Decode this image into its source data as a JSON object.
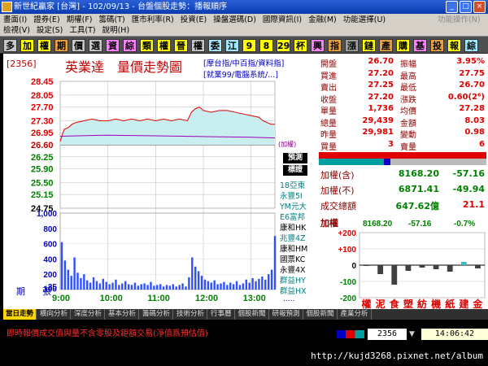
{
  "window": {
    "title": "新世紀贏家 [台灣] - 102/09/13 - 台盤個股走勢：播報順序",
    "buttons": [
      "_",
      "□",
      "×"
    ]
  },
  "menu": {
    "row1": [
      "畫面(I)",
      "證券(E)",
      "期權(F)",
      "籌碼(T)",
      "匯市利率(R)",
      "投資(E)",
      "操盤選碼(D)",
      "國際資訊(I)",
      "金融(M)",
      "功能選擇(U)"
    ],
    "row1_right": "功能操作(N)",
    "row2": [
      "檢視(V)",
      "設定(S)",
      "工具(T)",
      "說明(H)"
    ]
  },
  "toolbar": {
    "items": [
      "多",
      "加",
      "權",
      "期",
      "價",
      "選",
      "資",
      "綜",
      "類",
      "權",
      "晉",
      "權",
      "委",
      "江",
      "9",
      "8",
      "29",
      "杯",
      "興",
      "指",
      "漲",
      "鏈",
      "產",
      "購",
      "基",
      "投",
      "報",
      "綜"
    ]
  },
  "header": {
    "code": "2356",
    "name": "英業達",
    "subtitle": "量價走勢圖",
    "links1": "[摩台指/中百指/資料指]",
    "links2": "[就業99/電腦系統/...]",
    "side_note": "(加權)"
  },
  "chart_data": {
    "type": "line",
    "title": "量價走勢圖",
    "reference_price": 26.6,
    "price_ticks": [
      28.45,
      28.05,
      27.7,
      27.3,
      26.95,
      26.6,
      26.25,
      25.9,
      25.5,
      25.15,
      24.75
    ],
    "price_ylim": [
      24.75,
      28.45
    ],
    "volume_ticks": [
      "1,000",
      "800",
      "600",
      "400",
      "200",
      "100",
      "35"
    ],
    "volume_label": "張",
    "lot_label": "期",
    "time_ticks": [
      "9:00",
      "10:00",
      "11:00",
      "12:00",
      "13:00"
    ],
    "price_series": [
      {
        "t": 0,
        "v": 26.7
      },
      {
        "t": 5,
        "v": 27.05
      },
      {
        "t": 10,
        "v": 27.1
      },
      {
        "t": 15,
        "v": 27.2
      },
      {
        "t": 20,
        "v": 27.25
      },
      {
        "t": 30,
        "v": 27.3
      },
      {
        "t": 40,
        "v": 27.35
      },
      {
        "t": 50,
        "v": 27.3
      },
      {
        "t": 60,
        "v": 27.3
      },
      {
        "t": 70,
        "v": 27.35
      },
      {
        "t": 80,
        "v": 27.3
      },
      {
        "t": 90,
        "v": 27.35
      },
      {
        "t": 100,
        "v": 27.3
      },
      {
        "t": 110,
        "v": 27.35
      },
      {
        "t": 120,
        "v": 27.3
      },
      {
        "t": 130,
        "v": 27.35
      },
      {
        "t": 140,
        "v": 27.3
      },
      {
        "t": 150,
        "v": 27.35
      },
      {
        "t": 160,
        "v": 27.3
      },
      {
        "t": 165,
        "v": 27.55
      },
      {
        "t": 170,
        "v": 27.65
      },
      {
        "t": 175,
        "v": 27.7
      },
      {
        "t": 180,
        "v": 27.6
      },
      {
        "t": 190,
        "v": 27.55
      },
      {
        "t": 200,
        "v": 27.6
      },
      {
        "t": 210,
        "v": 27.6
      },
      {
        "t": 220,
        "v": 27.55
      },
      {
        "t": 230,
        "v": 27.5
      },
      {
        "t": 240,
        "v": 27.45
      },
      {
        "t": 250,
        "v": 27.4
      },
      {
        "t": 255,
        "v": 27.3
      },
      {
        "t": 260,
        "v": 27.25
      },
      {
        "t": 265,
        "v": 27.2
      },
      {
        "t": 270,
        "v": 27.2
      }
    ],
    "avg_series": [
      {
        "t": 0,
        "v": 26.85
      },
      {
        "t": 60,
        "v": 26.88
      },
      {
        "t": 120,
        "v": 26.86
      },
      {
        "t": 180,
        "v": 26.84
      },
      {
        "t": 240,
        "v": 26.82
      },
      {
        "t": 270,
        "v": 26.8
      }
    ],
    "volume": [
      {
        "t": 2,
        "v": 620
      },
      {
        "t": 6,
        "v": 380
      },
      {
        "t": 10,
        "v": 260
      },
      {
        "t": 14,
        "v": 180
      },
      {
        "t": 18,
        "v": 420
      },
      {
        "t": 22,
        "v": 220
      },
      {
        "t": 26,
        "v": 150
      },
      {
        "t": 30,
        "v": 200
      },
      {
        "t": 34,
        "v": 120
      },
      {
        "t": 38,
        "v": 90
      },
      {
        "t": 42,
        "v": 160
      },
      {
        "t": 46,
        "v": 110
      },
      {
        "t": 50,
        "v": 80
      },
      {
        "t": 54,
        "v": 140
      },
      {
        "t": 58,
        "v": 100
      },
      {
        "t": 62,
        "v": 70
      },
      {
        "t": 66,
        "v": 90
      },
      {
        "t": 70,
        "v": 130
      },
      {
        "t": 74,
        "v": 60
      },
      {
        "t": 78,
        "v": 80
      },
      {
        "t": 82,
        "v": 110
      },
      {
        "t": 86,
        "v": 70
      },
      {
        "t": 90,
        "v": 60
      },
      {
        "t": 94,
        "v": 90
      },
      {
        "t": 98,
        "v": 50
      },
      {
        "t": 102,
        "v": 70
      },
      {
        "t": 106,
        "v": 80
      },
      {
        "t": 110,
        "v": 60
      },
      {
        "t": 114,
        "v": 100
      },
      {
        "t": 118,
        "v": 50
      },
      {
        "t": 122,
        "v": 60
      },
      {
        "t": 126,
        "v": 70
      },
      {
        "t": 130,
        "v": 40
      },
      {
        "t": 134,
        "v": 60
      },
      {
        "t": 138,
        "v": 50
      },
      {
        "t": 142,
        "v": 70
      },
      {
        "t": 146,
        "v": 40
      },
      {
        "t": 150,
        "v": 60
      },
      {
        "t": 154,
        "v": 80
      },
      {
        "t": 158,
        "v": 40
      },
      {
        "t": 162,
        "v": 160
      },
      {
        "t": 166,
        "v": 420
      },
      {
        "t": 170,
        "v": 300
      },
      {
        "t": 174,
        "v": 240
      },
      {
        "t": 178,
        "v": 180
      },
      {
        "t": 182,
        "v": 130
      },
      {
        "t": 186,
        "v": 110
      },
      {
        "t": 190,
        "v": 90
      },
      {
        "t": 194,
        "v": 120
      },
      {
        "t": 198,
        "v": 70
      },
      {
        "t": 202,
        "v": 80
      },
      {
        "t": 206,
        "v": 100
      },
      {
        "t": 210,
        "v": 60
      },
      {
        "t": 214,
        "v": 90
      },
      {
        "t": 218,
        "v": 70
      },
      {
        "t": 222,
        "v": 110
      },
      {
        "t": 226,
        "v": 60
      },
      {
        "t": 230,
        "v": 80
      },
      {
        "t": 234,
        "v": 130
      },
      {
        "t": 238,
        "v": 90
      },
      {
        "t": 242,
        "v": 150
      },
      {
        "t": 246,
        "v": 110
      },
      {
        "t": 250,
        "v": 140
      },
      {
        "t": 254,
        "v": 170
      },
      {
        "t": 258,
        "v": 130
      },
      {
        "t": 262,
        "v": 200
      },
      {
        "t": 266,
        "v": 260
      },
      {
        "t": 270,
        "v": 700
      }
    ],
    "grid": true
  },
  "broker_list": {
    "buttons": [
      "預測",
      "標證"
    ],
    "items": [
      "18亞東",
      "永豐5I",
      "YM元大",
      "E6富邦",
      "康和HK",
      "兆豐4Z",
      "康和HM",
      "國票KC",
      "永豐4X",
      "群益HY",
      "群益HX"
    ],
    "more": "....."
  },
  "quote": {
    "rows": [
      {
        "l1": "開盤",
        "v1": "26.70",
        "c1": "red",
        "l2": "振幅",
        "v2": "3.95%",
        "c2": "red"
      },
      {
        "l1": "買進",
        "v1": "27.20",
        "c1": "red",
        "l2": "最高",
        "v2": "27.75",
        "c2": "red"
      },
      {
        "l1": "賣出",
        "v1": "27.25",
        "c1": "red",
        "l2": "最低",
        "v2": "26.70",
        "c2": "red"
      },
      {
        "l1": "收盤",
        "v1": "27.20",
        "c1": "red",
        "l2": "漲跌",
        "v2": "0.60(2⁶)",
        "c2": "red"
      },
      {
        "l1": "單量",
        "v1": "1,736",
        "c1": "red",
        "l2": "均價",
        "v2": "27.28",
        "c2": "red"
      },
      {
        "l1": "總量",
        "v1": "29,439",
        "c1": "red",
        "l2": "金額",
        "v2": "8.03",
        "c2": "red"
      },
      {
        "l1": "昨量",
        "v1": "29,981",
        "c1": "red",
        "l2": "變動",
        "v2": "0.98",
        "c2": "red"
      },
      {
        "l1": "買量",
        "v1": "3",
        "c1": "red",
        "l2": "賣量",
        "v2": "6",
        "c2": "red"
      }
    ]
  },
  "index": {
    "rows": [
      {
        "label": "加權(含)",
        "value": "8168.20",
        "change": "-57.16"
      },
      {
        "label": "加權(不)",
        "value": "6871.41",
        "change": "-49.94"
      },
      {
        "label": "成交總額",
        "value": "647.62億",
        "change": "21.1"
      }
    ]
  },
  "sector": {
    "label": "加權",
    "value": "8168.20",
    "change": "-57.16",
    "pct": "-0.7%",
    "ticks": [
      "+200",
      "+100",
      "0",
      "-100",
      "-200"
    ],
    "ylim": [
      -200,
      200
    ],
    "categories": [
      "權",
      "泥",
      "食",
      "塑",
      "紡",
      "機",
      "紙",
      "建",
      "金"
    ],
    "values": [
      -5,
      -55,
      -120,
      -35,
      -15,
      -25,
      -40,
      20,
      -20
    ],
    "cat_colors": [
      "#e00000",
      "#e00000",
      "#e00000",
      "#e00000",
      "#e00000",
      "#e00000",
      "#e00000",
      "#e00000",
      "#e00000"
    ]
  },
  "tabs": [
    "當日走勢",
    "橫向分析",
    "深度分析",
    "基本分析",
    "籌碼分析",
    "技術分析",
    "行事曆",
    "個股新聞",
    "研報預測",
    "個股新聞",
    "產業分析"
  ],
  "status": {
    "message": "即時報價成交值與量不含零股及鉅額交易(淨值爲預估值)",
    "code": "2356",
    "time": "14:06:42"
  },
  "watermark": "http://kujd3268.pixnet.net/album"
}
